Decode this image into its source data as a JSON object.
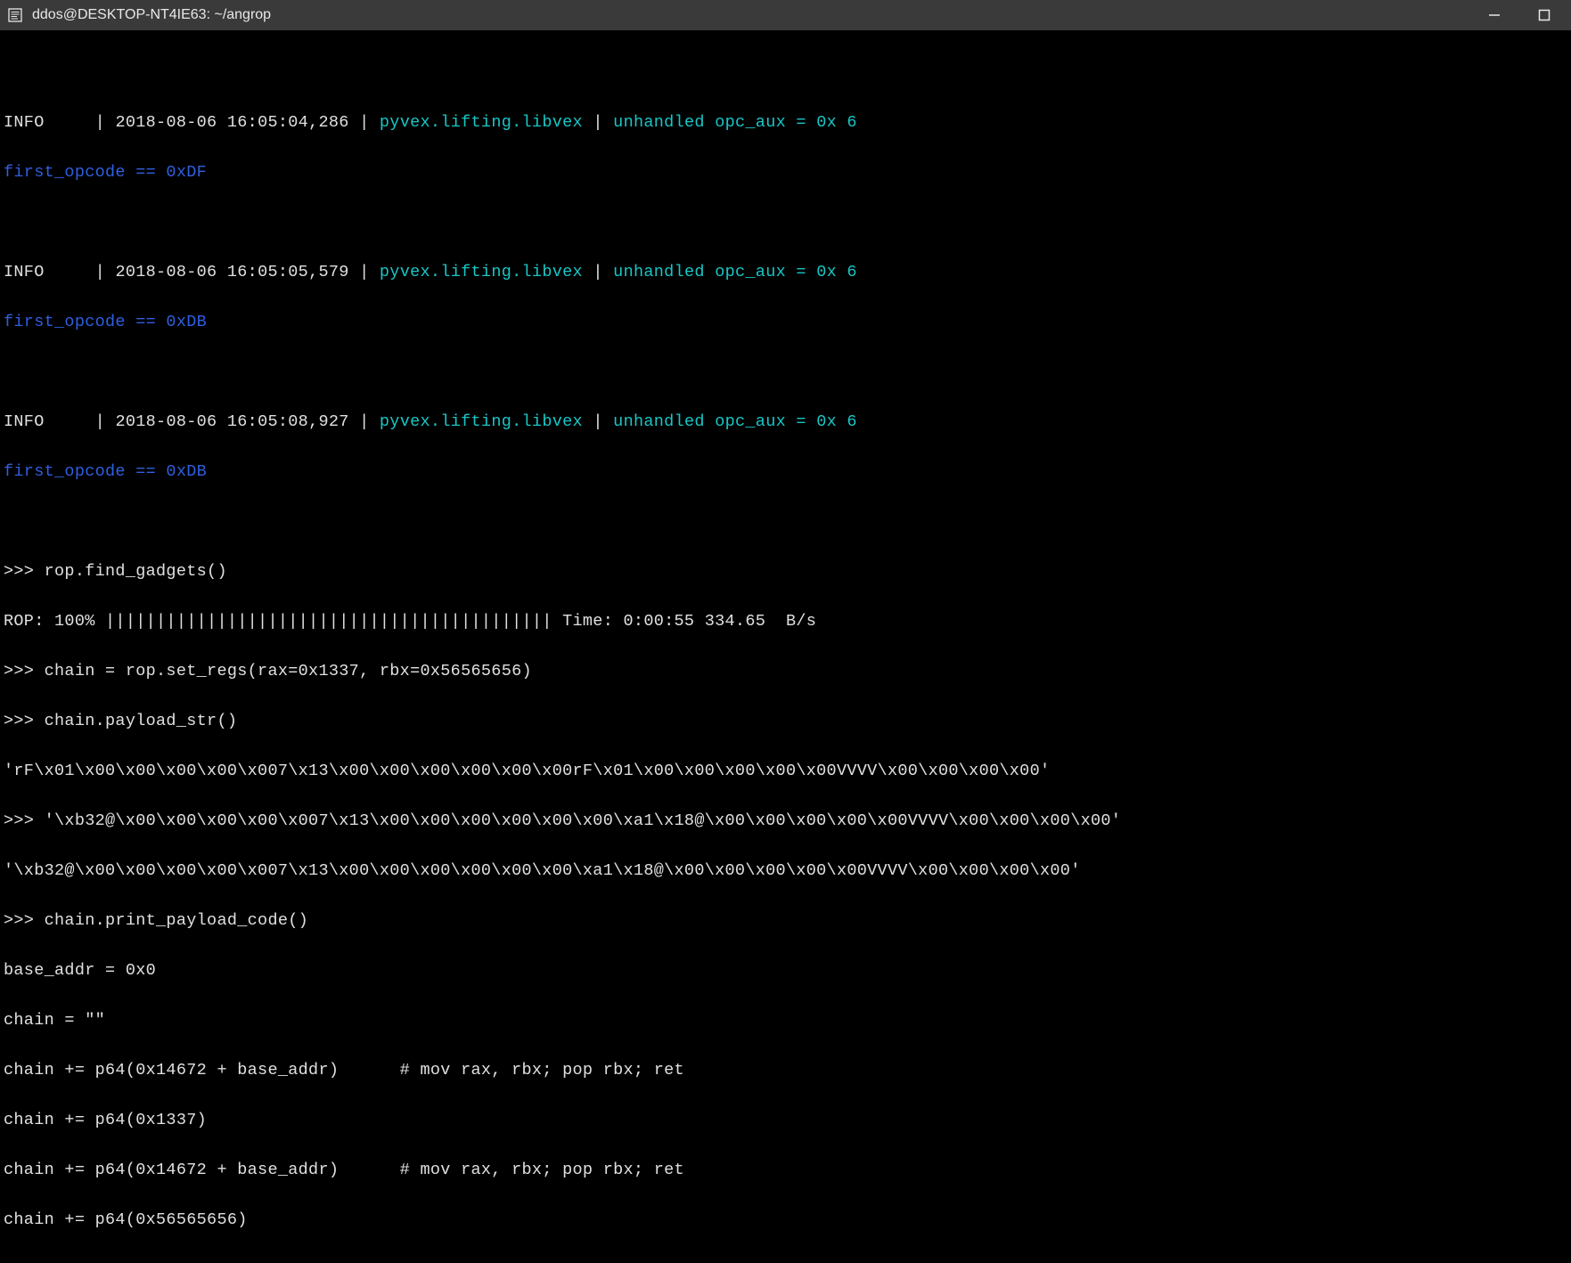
{
  "titlebar": {
    "title": "ddos@DESKTOP-NT4IE63: ~/angrop"
  },
  "info1": {
    "level": "INFO    ",
    "sep1": " | ",
    "ts": "2018-08-06 16:05:04,286",
    "sep2": " | ",
    "module": "pyvex.lifting.libvex",
    "sep3": " | ",
    "msg": "unhandled opc_aux = 0x 6",
    "extra": "first_opcode == 0xDF"
  },
  "info2": {
    "level": "INFO    ",
    "sep1": " | ",
    "ts": "2018-08-06 16:05:05,579",
    "sep2": " | ",
    "module": "pyvex.lifting.libvex",
    "sep3": " | ",
    "msg": "unhandled opc_aux = 0x 6",
    "extra": "first_opcode == 0xDB"
  },
  "info3": {
    "level": "INFO    ",
    "sep1": " | ",
    "ts": "2018-08-06 16:05:08,927",
    "sep2": " | ",
    "module": "pyvex.lifting.libvex",
    "sep3": " | ",
    "msg": "unhandled opc_aux = 0x 6",
    "extra": "first_opcode == 0xDB"
  },
  "lines": {
    "l1": ">>> rop.find_gadgets()",
    "l2": "ROP: 100% |||||||||||||||||||||||||||||||||||||||||||| Time: 0:00:55 334.65  B/s",
    "l3": ">>> chain = rop.set_regs(rax=0x1337, rbx=0x56565656)",
    "l4": ">>> chain.payload_str()",
    "l5": "'rF\\x01\\x00\\x00\\x00\\x00\\x007\\x13\\x00\\x00\\x00\\x00\\x00\\x00rF\\x01\\x00\\x00\\x00\\x00\\x00VVVV\\x00\\x00\\x00\\x00'",
    "l6": ">>> '\\xb32@\\x00\\x00\\x00\\x00\\x007\\x13\\x00\\x00\\x00\\x00\\x00\\x00\\xa1\\x18@\\x00\\x00\\x00\\x00\\x00VVVV\\x00\\x00\\x00\\x00'",
    "l7": "'\\xb32@\\x00\\x00\\x00\\x00\\x007\\x13\\x00\\x00\\x00\\x00\\x00\\x00\\xa1\\x18@\\x00\\x00\\x00\\x00\\x00VVVV\\x00\\x00\\x00\\x00'",
    "l8": ">>> chain.print_payload_code()",
    "l9": "base_addr = 0x0",
    "l10": "chain = \"\"",
    "l11": "chain += p64(0x14672 + base_addr)      # mov rax, rbx; pop rbx; ret",
    "l12": "chain += p64(0x1337)",
    "l13": "chain += p64(0x14672 + base_addr)      # mov rax, rbx; pop rbx; ret",
    "l14": "chain += p64(0x56565656)"
  }
}
